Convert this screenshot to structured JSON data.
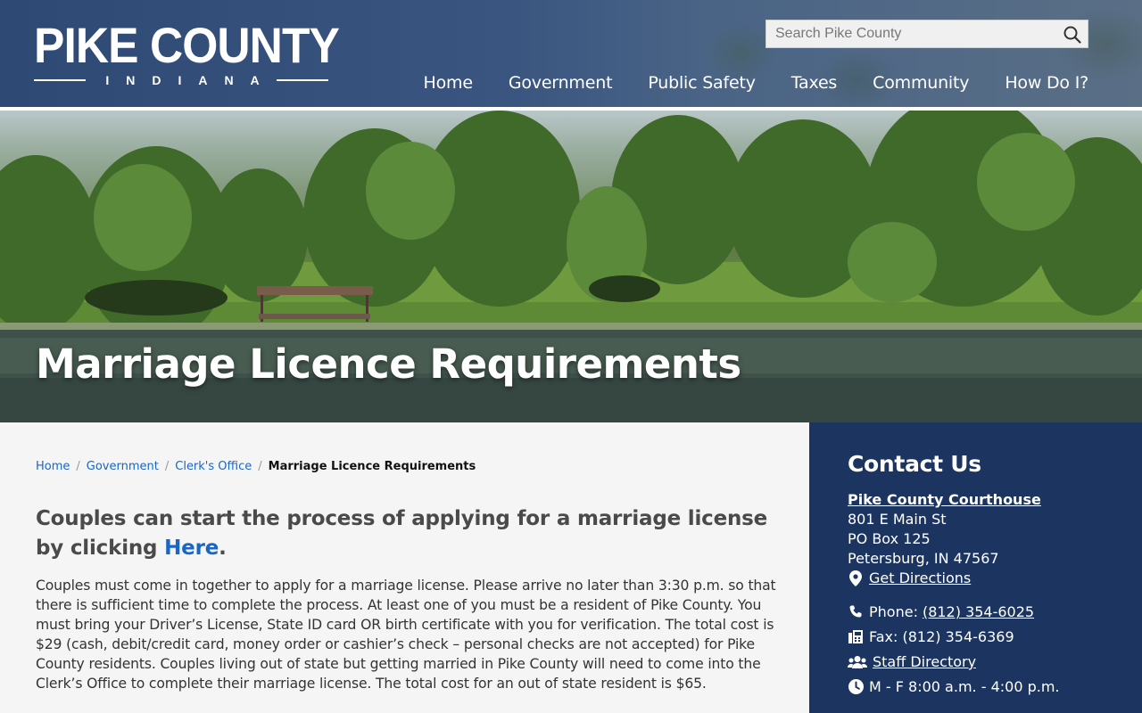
{
  "site": {
    "logo_title": "PIKE COUNTY",
    "logo_subtitle": "INDIANA"
  },
  "search": {
    "placeholder": "Search Pike County",
    "icon": "search-icon"
  },
  "nav": {
    "items": [
      "Home",
      "Government",
      "Public Safety",
      "Taxes",
      "Community",
      "How Do I?"
    ]
  },
  "hero": {
    "title": "Marriage Licence Requirements"
  },
  "breadcrumb": {
    "items": [
      "Home",
      "Government",
      "Clerk's Office"
    ],
    "separator": "/",
    "current": "Marriage Licence Requirements"
  },
  "content": {
    "lead_text": "Couples can start the process of applying for a marriage license by clicking ",
    "lead_link": "Here",
    "lead_end": ".",
    "body": "Couples must come in together to apply for a marriage license. Please arrive no later than 3:30 p.m. so that there is sufficient time to complete the process. At least one of you must be a resident of Pike County. You must bring your Driver’s License, State ID card OR birth certificate with you for verification. The total cost is $29 (cash, debit/credit card, money order or cashier’s check – personal checks are not accepted) for Pike County residents. Couples living out of state but getting married in Pike County will need to come into the Clerk’s Office to complete their marriage license. The total cost for an out of state resident is $65."
  },
  "contact": {
    "title": "Contact Us",
    "org": "Pike County Courthouse",
    "address1": "801 E Main St",
    "address2": "PO Box 125",
    "address3": "Petersburg, IN 47567",
    "directions": "Get Directions",
    "phone_label": "Phone: ",
    "phone": "(812) 354-6025",
    "fax": "Fax: (812) 354-6369",
    "staff": "Staff Directory",
    "hours": "M - F 8:00 a.m. - 4:00 p.m."
  },
  "colors": {
    "header_bg": "#2e4a74",
    "sidebar_bg": "#1c3560",
    "link": "#1a66c4",
    "page_bg": "#f5f5f5"
  }
}
